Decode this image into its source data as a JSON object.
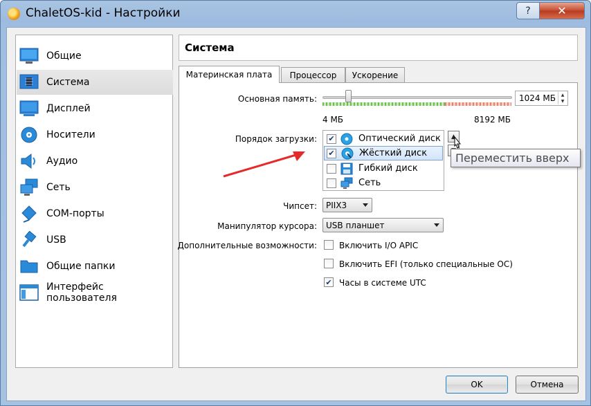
{
  "window": {
    "title": "ChaletOS-kid - Настройки",
    "help": "?",
    "close": "✕"
  },
  "sidebar": {
    "items": [
      {
        "label": "Общие",
        "icon": "monitor-icon"
      },
      {
        "label": "Система",
        "icon": "chip-icon"
      },
      {
        "label": "Дисплей",
        "icon": "display-icon"
      },
      {
        "label": "Носители",
        "icon": "disk-icon"
      },
      {
        "label": "Аудио",
        "icon": "speaker-icon"
      },
      {
        "label": "Сеть",
        "icon": "network-icon"
      },
      {
        "label": "COM-порты",
        "icon": "serial-port-icon"
      },
      {
        "label": "USB",
        "icon": "usb-icon"
      },
      {
        "label": "Общие папки",
        "icon": "folder-icon"
      },
      {
        "label": "Интерфейс пользователя",
        "icon": "ui-window-icon"
      }
    ],
    "selected": "Система"
  },
  "section_title": "Система",
  "tabs": [
    {
      "label": "Материнская плата"
    },
    {
      "label": "Процессор"
    },
    {
      "label": "Ускорение"
    }
  ],
  "motherboard": {
    "memory_label": "Основная память:",
    "memory_value": "1024 МБ",
    "memory_min": "4 МБ",
    "memory_max": "8192 МБ",
    "memory_fraction": 0.125,
    "boot_label": "Порядок загрузки:",
    "boot_items": [
      {
        "label": "Оптический диск",
        "checked": true,
        "icon": "optical-disc-icon"
      },
      {
        "label": "Жёсткий диск",
        "checked": true,
        "icon": "hard-disk-icon"
      },
      {
        "label": "Гибкий диск",
        "checked": false,
        "icon": "floppy-disk-icon"
      },
      {
        "label": "Сеть",
        "checked": false,
        "icon": "network-icon"
      }
    ],
    "tooltip": "Переместить вверх",
    "chipset_label": "Чипсет:",
    "chipset_value": "PIIX3",
    "pointing_label": "Манипулятор курсора:",
    "pointing_value": "USB планшет",
    "extended_label": "Дополнительные возможности:",
    "extended": [
      {
        "label": "Включить I/O APIC",
        "checked": false
      },
      {
        "label": "Включить EFI (только специальные ОС)",
        "checked": false
      },
      {
        "label": "Часы в системе UTC",
        "checked": true
      }
    ]
  },
  "buttons": {
    "ok": "OK",
    "cancel": "Отмена"
  },
  "colors": {
    "accent_red": "#e52a2a",
    "selection": "#d3e5fa",
    "titlebar": "#9dbbdf"
  }
}
